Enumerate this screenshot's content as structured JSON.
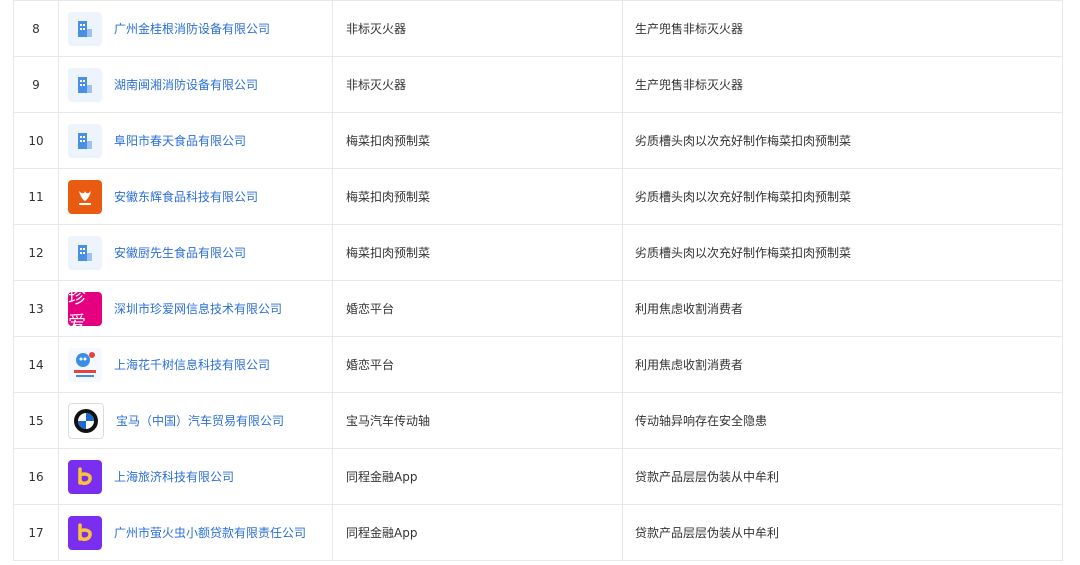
{
  "rows": [
    {
      "index": "8",
      "company": "广州金桂根消防设备有限公司",
      "product": "非标灭火器",
      "reason": "生产兜售非标灭火器",
      "logo": "building-icon"
    },
    {
      "index": "9",
      "company": "湖南闽湘消防设备有限公司",
      "product": "非标灭火器",
      "reason": "生产兜售非标灭火器",
      "logo": "building-icon"
    },
    {
      "index": "10",
      "company": "阜阳市春天食品有限公司",
      "product": "梅菜扣肉预制菜",
      "reason": "劣质槽头肉以次充好制作梅菜扣肉预制菜",
      "logo": "building-icon"
    },
    {
      "index": "11",
      "company": "安徽东辉食品科技有限公司",
      "product": "梅菜扣肉预制菜",
      "reason": "劣质槽头肉以次充好制作梅菜扣肉预制菜",
      "logo": "donghui-logo-icon"
    },
    {
      "index": "12",
      "company": "安徽厨先生食品有限公司",
      "product": "梅菜扣肉预制菜",
      "reason": "劣质槽头肉以次充好制作梅菜扣肉预制菜",
      "logo": "building-icon"
    },
    {
      "index": "13",
      "company": "深圳市珍爱网信息技术有限公司",
      "product": "婚恋平台",
      "reason": "利用焦虑收割消费者",
      "logo": "zhenai-logo-icon",
      "logo_text": "珍爱"
    },
    {
      "index": "14",
      "company": "上海花千树信息科技有限公司",
      "product": "婚恋平台",
      "reason": "利用焦虑收割消费者",
      "logo": "jiayuan-logo-icon"
    },
    {
      "index": "15",
      "company": "宝马（中国）汽车贸易有限公司",
      "product": "宝马汽车传动轴",
      "reason": "传动轴异响存在安全隐患",
      "logo": "bmw-logo-icon"
    },
    {
      "index": "16",
      "company": "上海旅济科技有限公司",
      "product": "同程金融App",
      "reason": "贷款产品层层伪装从中牟利",
      "logo": "tongcheng-logo-icon"
    },
    {
      "index": "17",
      "company": "广州市萤火虫小额贷款有限责任公司",
      "product": "同程金融App",
      "reason": "贷款产品层层伪装从中牟利",
      "logo": "tongcheng-logo-icon"
    }
  ],
  "colors": {
    "link": "#2b6fd8",
    "text": "#333333",
    "border": "#e8e8e8"
  }
}
